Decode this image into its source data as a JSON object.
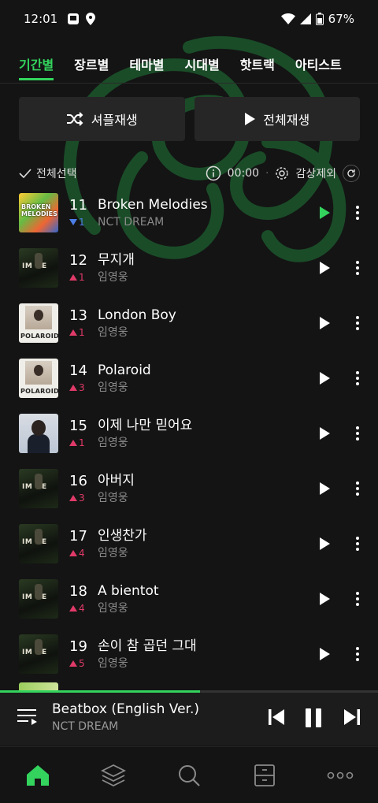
{
  "status_bar": {
    "time": "12:01",
    "battery": "67%"
  },
  "tabs": [
    {
      "label": "기간별",
      "active": true
    },
    {
      "label": "장르별",
      "active": false
    },
    {
      "label": "테마별",
      "active": false
    },
    {
      "label": "시대별",
      "active": false
    },
    {
      "label": "핫트랙",
      "active": false
    },
    {
      "label": "아티스트",
      "active": false
    }
  ],
  "actions": {
    "shuffle_label": "셔플재생",
    "play_all_label": "전체재생"
  },
  "controls": {
    "select_all_label": "전체선택",
    "timer_value": "00:00",
    "exclude_label": "감상제외"
  },
  "songs": [
    {
      "rank": "11",
      "change": "1",
      "direction": "down",
      "title": "Broken Melodies",
      "artist": "NCT DREAM",
      "thumb": "colorful",
      "thumb_text": "BROKEN MELODIES",
      "playing": true
    },
    {
      "rank": "12",
      "change": "1",
      "direction": "up",
      "title": "무지개",
      "artist": "임영웅",
      "thumb": "dark",
      "playing": false
    },
    {
      "rank": "13",
      "change": "1",
      "direction": "up",
      "title": "London Boy",
      "artist": "임영웅",
      "thumb": "polaroid",
      "thumb_text": "POLAROID",
      "playing": false
    },
    {
      "rank": "14",
      "change": "3",
      "direction": "up",
      "title": "Polaroid",
      "artist": "임영웅",
      "thumb": "polaroid",
      "thumb_text": "POLAROID",
      "playing": false
    },
    {
      "rank": "15",
      "change": "1",
      "direction": "up",
      "title": "이제 나만 믿어요",
      "artist": "임영웅",
      "thumb": "portrait",
      "playing": false
    },
    {
      "rank": "16",
      "change": "3",
      "direction": "up",
      "title": "아버지",
      "artist": "임영웅",
      "thumb": "dark",
      "playing": false
    },
    {
      "rank": "17",
      "change": "4",
      "direction": "up",
      "title": "인생찬가",
      "artist": "임영웅",
      "thumb": "dark",
      "playing": false
    },
    {
      "rank": "18",
      "change": "4",
      "direction": "up",
      "title": "A bientot",
      "artist": "임영웅",
      "thumb": "dark",
      "playing": false
    },
    {
      "rank": "19",
      "change": "5",
      "direction": "up",
      "title": "손이 참 곱던 그대",
      "artist": "임영웅",
      "thumb": "dark",
      "playing": false
    }
  ],
  "now_playing": {
    "title": "Beatbox (English Ver.)",
    "artist": "NCT DREAM",
    "progress": 0.53
  },
  "nav": [
    {
      "icon": "home-icon",
      "active": true
    },
    {
      "icon": "layers-icon",
      "active": false
    },
    {
      "icon": "search-icon",
      "active": false
    },
    {
      "icon": "library-icon",
      "active": false
    },
    {
      "icon": "more-icon",
      "active": false
    }
  ],
  "colors": {
    "accent": "#33d35d",
    "up": "#e03a68",
    "down": "#4c7ee8",
    "background": "#141414"
  }
}
